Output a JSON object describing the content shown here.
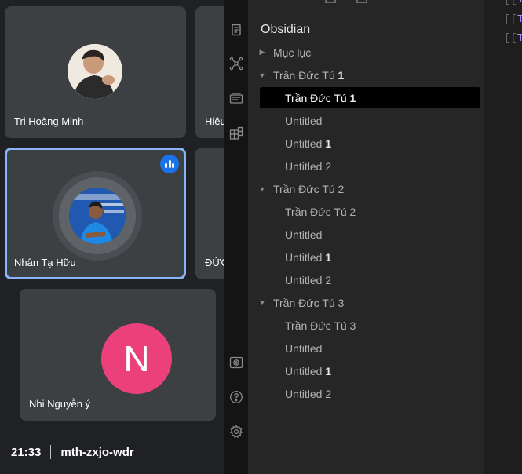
{
  "meet": {
    "participants": [
      {
        "name": "Tri Hoàng Minh",
        "avatar": "photo"
      },
      {
        "name": "Hiệu",
        "avatar": "photo"
      },
      {
        "name": "Nhân Tạ Hữu",
        "avatar": "photo",
        "speaking": true
      },
      {
        "name": "ĐỨC",
        "avatar": "photo"
      },
      {
        "name": "Nhi Nguyễn ý",
        "avatar": "letter",
        "letter": "N",
        "color": "#ec407a"
      }
    ],
    "footer": {
      "time": "21:33",
      "meeting_code": "mth-zxjo-wdr"
    },
    "accent_color": "#8ab4f8"
  },
  "obsidian": {
    "ribbon_icons": [
      "files-icon",
      "graph-icon",
      "slides-icon",
      "kanban-icon",
      "publish-icon",
      "help-icon",
      "settings-icon"
    ],
    "vault_title": "Obsidian",
    "tree": [
      {
        "type": "folder",
        "label": "Mục lục",
        "collapsed": true
      },
      {
        "type": "folder",
        "label": "Trần Đức Tú ",
        "num": "1"
      },
      {
        "type": "file",
        "label": "Trần Đức Tú ",
        "num": "1",
        "active": true
      },
      {
        "type": "file",
        "label": "Untitled",
        "num": ""
      },
      {
        "type": "file",
        "label": "Untitled ",
        "num": "1"
      },
      {
        "type": "file",
        "label": "Untitled 2",
        "num": ""
      },
      {
        "type": "folder",
        "label": "Trần Đức Tú 2",
        "num": ""
      },
      {
        "type": "file",
        "label": "Trần Đức Tú 2",
        "num": ""
      },
      {
        "type": "file",
        "label": "Untitled",
        "num": ""
      },
      {
        "type": "file",
        "label": "Untitled ",
        "num": "1"
      },
      {
        "type": "file",
        "label": "Untitled 2",
        "num": ""
      },
      {
        "type": "folder",
        "label": "Trần Đức Tú 3",
        "num": ""
      },
      {
        "type": "file",
        "label": "Trần Đức Tú 3",
        "num": ""
      },
      {
        "type": "file",
        "label": "Untitled",
        "num": ""
      },
      {
        "type": "file",
        "label": "Untitled ",
        "num": "1"
      },
      {
        "type": "file",
        "label": "Untitled 2",
        "num": ""
      }
    ],
    "editor_lines": [
      {
        "open": "[[",
        "text": "Tr"
      },
      {
        "open": "[[",
        "text": "Tr"
      },
      {
        "open": "[[",
        "text": "Tr"
      }
    ]
  }
}
